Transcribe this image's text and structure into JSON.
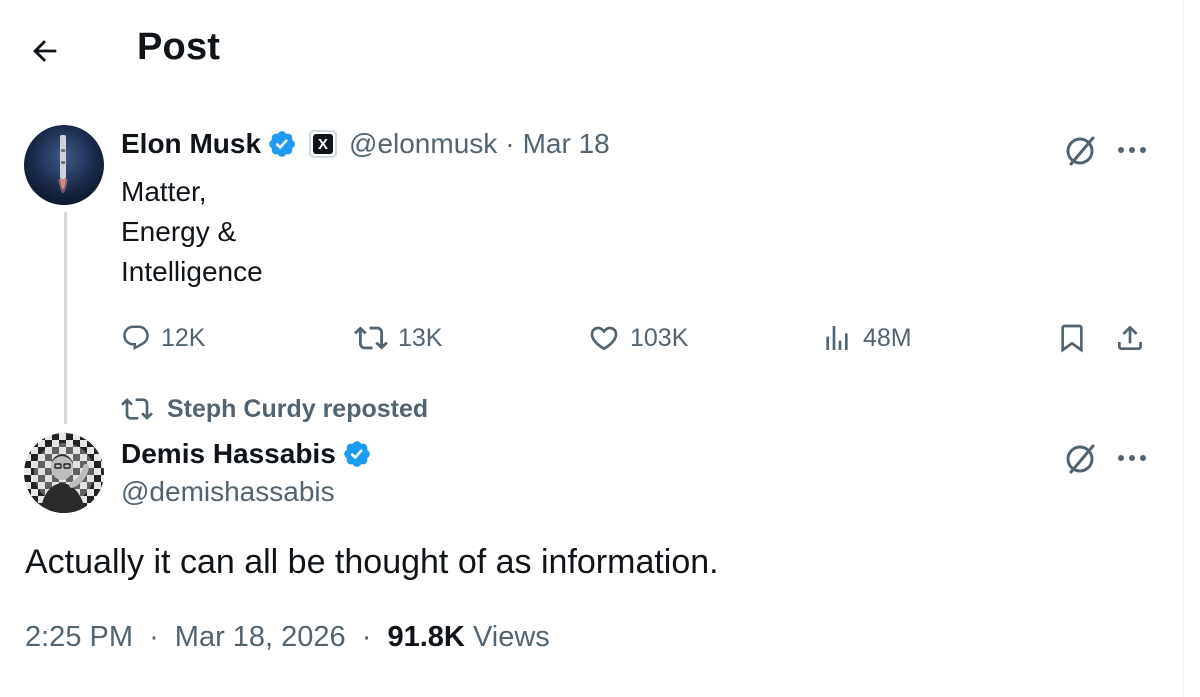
{
  "header": {
    "title": "Post",
    "back_icon": "arrow-left-icon"
  },
  "quoted_post": {
    "author_name": "Elon Musk",
    "verified": true,
    "affiliation_badge": "X",
    "handle": "@elonmusk",
    "separator": "·",
    "date": "Mar 18",
    "text_lines": [
      "Matter,",
      "Energy &",
      "Intelligence"
    ],
    "actions": {
      "replies": "12K",
      "reposts": "13K",
      "likes": "103K",
      "views": "48M"
    }
  },
  "repost_context": {
    "label": "Steph Curdy reposted"
  },
  "main_post": {
    "author_name": "Demis Hassabis",
    "verified": true,
    "handle": "@demishassabis",
    "text": "Actually it can all be thought of as information.",
    "time": "2:25 PM",
    "separator": "·",
    "date": "Mar 18, 2026",
    "views_count": "91.8K",
    "views_label": "Views"
  },
  "colors": {
    "text_primary": "#0f1419",
    "text_secondary": "#536471",
    "verified_blue": "#1d9bf0",
    "thread_line": "#cfd9de"
  }
}
